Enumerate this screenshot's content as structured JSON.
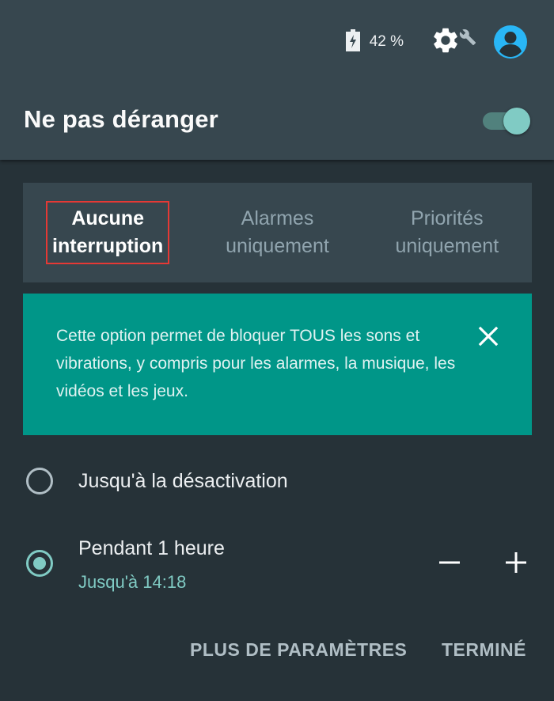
{
  "status_bar": {
    "battery_text": "42 %"
  },
  "header": {
    "title": "Ne pas déranger",
    "toggle_state": "on"
  },
  "tabs": [
    {
      "line1": "Aucune",
      "line2": "interruption",
      "selected": true
    },
    {
      "line1": "Alarmes",
      "line2": "uniquement",
      "selected": false
    },
    {
      "line1": "Priorités",
      "line2": "uniquement",
      "selected": false
    }
  ],
  "info_card": {
    "text": "Cette option permet de bloquer TOUS les sons et vibrations, y compris pour les alarmes, la musique, les vidéos et les jeux."
  },
  "options": {
    "until_off": {
      "label": "Jusqu'à la désactivation",
      "selected": false
    },
    "duration": {
      "label": "Pendant 1 heure",
      "sublabel": "Jusqu'à 14:18",
      "selected": true
    }
  },
  "actions": {
    "more_settings": "PLUS DE PARAMÈTRES",
    "done": "TERMINÉ"
  },
  "colors": {
    "header_bg": "#37474f",
    "body_bg": "#263238",
    "accent": "#80cbc4",
    "info_bg": "#009688",
    "highlight_border": "#e53935"
  }
}
